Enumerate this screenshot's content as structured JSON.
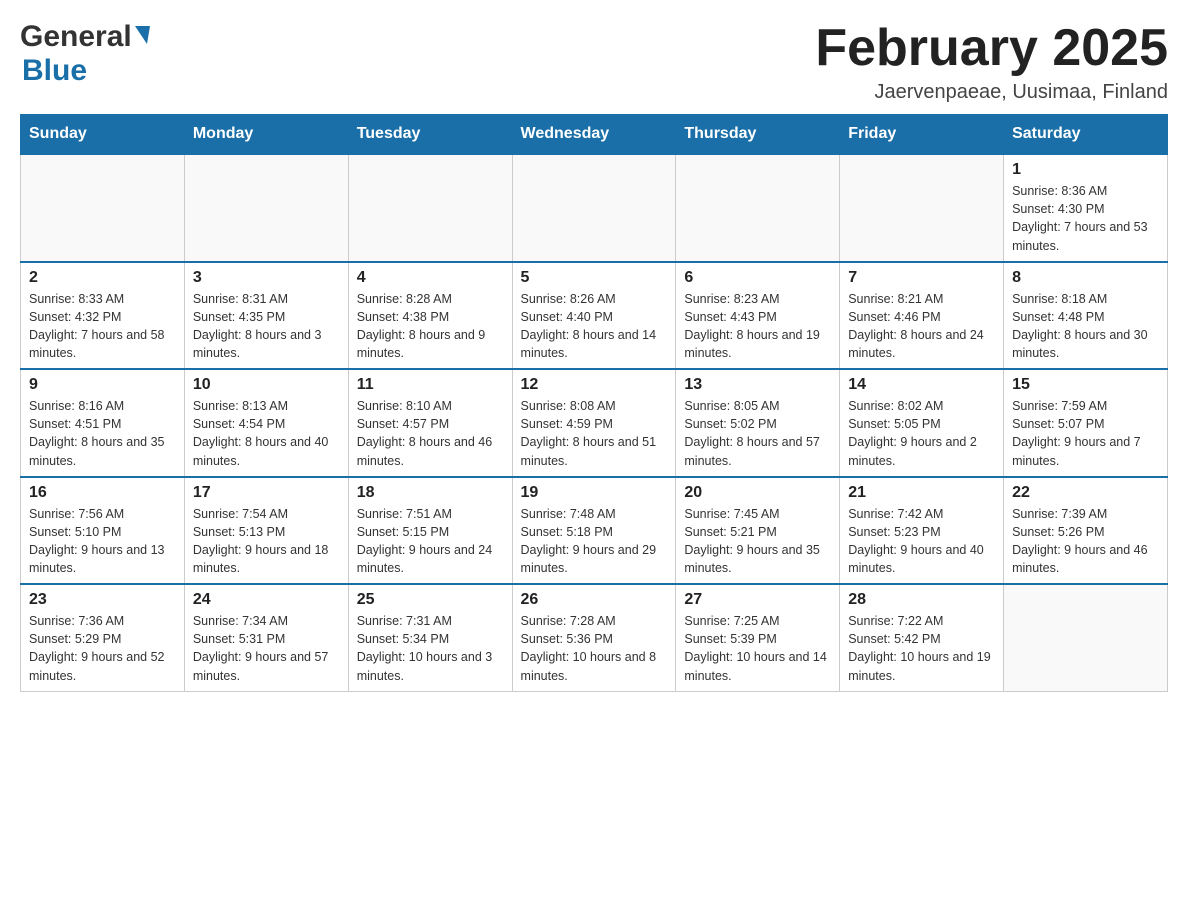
{
  "header": {
    "logo_general": "General",
    "logo_blue": "Blue",
    "title": "February 2025",
    "location": "Jaervenpaeae, Uusimaa, Finland"
  },
  "weekdays": [
    "Sunday",
    "Monday",
    "Tuesday",
    "Wednesday",
    "Thursday",
    "Friday",
    "Saturday"
  ],
  "weeks": [
    [
      {
        "day": "",
        "info": ""
      },
      {
        "day": "",
        "info": ""
      },
      {
        "day": "",
        "info": ""
      },
      {
        "day": "",
        "info": ""
      },
      {
        "day": "",
        "info": ""
      },
      {
        "day": "",
        "info": ""
      },
      {
        "day": "1",
        "info": "Sunrise: 8:36 AM\nSunset: 4:30 PM\nDaylight: 7 hours and 53 minutes."
      }
    ],
    [
      {
        "day": "2",
        "info": "Sunrise: 8:33 AM\nSunset: 4:32 PM\nDaylight: 7 hours and 58 minutes."
      },
      {
        "day": "3",
        "info": "Sunrise: 8:31 AM\nSunset: 4:35 PM\nDaylight: 8 hours and 3 minutes."
      },
      {
        "day": "4",
        "info": "Sunrise: 8:28 AM\nSunset: 4:38 PM\nDaylight: 8 hours and 9 minutes."
      },
      {
        "day": "5",
        "info": "Sunrise: 8:26 AM\nSunset: 4:40 PM\nDaylight: 8 hours and 14 minutes."
      },
      {
        "day": "6",
        "info": "Sunrise: 8:23 AM\nSunset: 4:43 PM\nDaylight: 8 hours and 19 minutes."
      },
      {
        "day": "7",
        "info": "Sunrise: 8:21 AM\nSunset: 4:46 PM\nDaylight: 8 hours and 24 minutes."
      },
      {
        "day": "8",
        "info": "Sunrise: 8:18 AM\nSunset: 4:48 PM\nDaylight: 8 hours and 30 minutes."
      }
    ],
    [
      {
        "day": "9",
        "info": "Sunrise: 8:16 AM\nSunset: 4:51 PM\nDaylight: 8 hours and 35 minutes."
      },
      {
        "day": "10",
        "info": "Sunrise: 8:13 AM\nSunset: 4:54 PM\nDaylight: 8 hours and 40 minutes."
      },
      {
        "day": "11",
        "info": "Sunrise: 8:10 AM\nSunset: 4:57 PM\nDaylight: 8 hours and 46 minutes."
      },
      {
        "day": "12",
        "info": "Sunrise: 8:08 AM\nSunset: 4:59 PM\nDaylight: 8 hours and 51 minutes."
      },
      {
        "day": "13",
        "info": "Sunrise: 8:05 AM\nSunset: 5:02 PM\nDaylight: 8 hours and 57 minutes."
      },
      {
        "day": "14",
        "info": "Sunrise: 8:02 AM\nSunset: 5:05 PM\nDaylight: 9 hours and 2 minutes."
      },
      {
        "day": "15",
        "info": "Sunrise: 7:59 AM\nSunset: 5:07 PM\nDaylight: 9 hours and 7 minutes."
      }
    ],
    [
      {
        "day": "16",
        "info": "Sunrise: 7:56 AM\nSunset: 5:10 PM\nDaylight: 9 hours and 13 minutes."
      },
      {
        "day": "17",
        "info": "Sunrise: 7:54 AM\nSunset: 5:13 PM\nDaylight: 9 hours and 18 minutes."
      },
      {
        "day": "18",
        "info": "Sunrise: 7:51 AM\nSunset: 5:15 PM\nDaylight: 9 hours and 24 minutes."
      },
      {
        "day": "19",
        "info": "Sunrise: 7:48 AM\nSunset: 5:18 PM\nDaylight: 9 hours and 29 minutes."
      },
      {
        "day": "20",
        "info": "Sunrise: 7:45 AM\nSunset: 5:21 PM\nDaylight: 9 hours and 35 minutes."
      },
      {
        "day": "21",
        "info": "Sunrise: 7:42 AM\nSunset: 5:23 PM\nDaylight: 9 hours and 40 minutes."
      },
      {
        "day": "22",
        "info": "Sunrise: 7:39 AM\nSunset: 5:26 PM\nDaylight: 9 hours and 46 minutes."
      }
    ],
    [
      {
        "day": "23",
        "info": "Sunrise: 7:36 AM\nSunset: 5:29 PM\nDaylight: 9 hours and 52 minutes."
      },
      {
        "day": "24",
        "info": "Sunrise: 7:34 AM\nSunset: 5:31 PM\nDaylight: 9 hours and 57 minutes."
      },
      {
        "day": "25",
        "info": "Sunrise: 7:31 AM\nSunset: 5:34 PM\nDaylight: 10 hours and 3 minutes."
      },
      {
        "day": "26",
        "info": "Sunrise: 7:28 AM\nSunset: 5:36 PM\nDaylight: 10 hours and 8 minutes."
      },
      {
        "day": "27",
        "info": "Sunrise: 7:25 AM\nSunset: 5:39 PM\nDaylight: 10 hours and 14 minutes."
      },
      {
        "day": "28",
        "info": "Sunrise: 7:22 AM\nSunset: 5:42 PM\nDaylight: 10 hours and 19 minutes."
      },
      {
        "day": "",
        "info": ""
      }
    ]
  ]
}
